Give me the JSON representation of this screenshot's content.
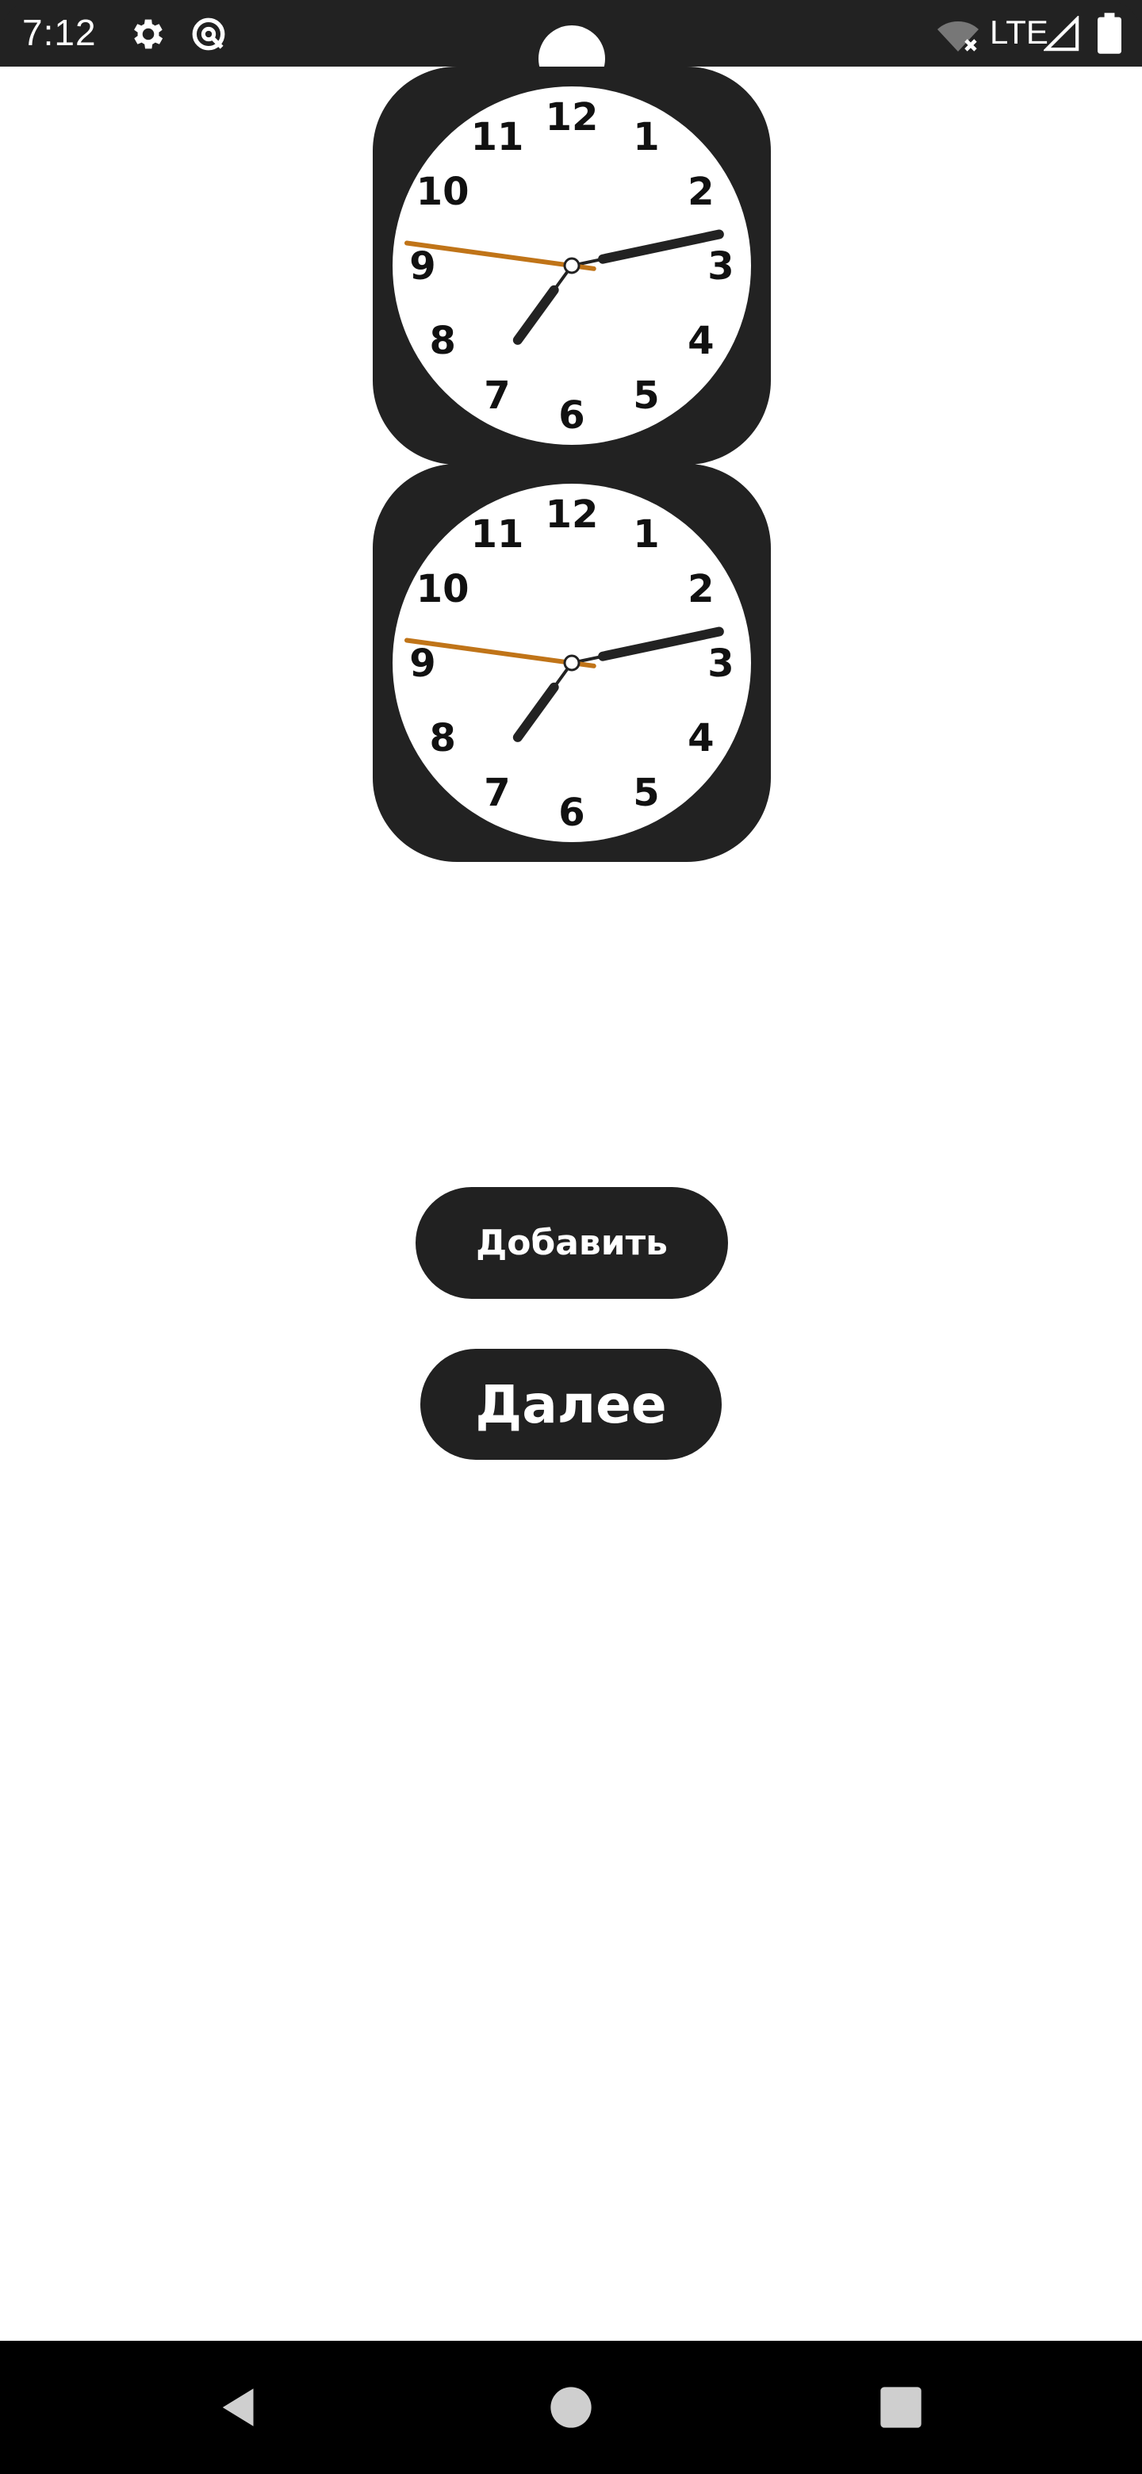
{
  "status_bar": {
    "time": "7:12",
    "network": "LTE",
    "icons": [
      "gear-icon",
      "data-saver-icon",
      "wifi-off-icon",
      "signal-icon",
      "battery-icon"
    ]
  },
  "clocks": [
    {
      "numerals": [
        "12",
        "1",
        "2",
        "3",
        "4",
        "5",
        "6",
        "7",
        "8",
        "9",
        "10",
        "11"
      ],
      "hour_hand_position": 7.2,
      "minute_hand_position_minutes": 13,
      "second_hand_position_seconds": 46.3
    },
    {
      "numerals": [
        "12",
        "1",
        "2",
        "3",
        "4",
        "5",
        "6",
        "7",
        "8",
        "9",
        "10",
        "11"
      ],
      "hour_hand_position": 7.2,
      "minute_hand_position_minutes": 13,
      "second_hand_position_seconds": 46.3
    }
  ],
  "colors": {
    "clock_body": "#222222",
    "second_hand": "#c07418",
    "button_bg": "#212121"
  },
  "buttons": {
    "add_label": "Добавить",
    "next_label": "Далее"
  },
  "nav_bar": {
    "icons": [
      "back-icon",
      "home-icon",
      "recents-icon"
    ]
  }
}
